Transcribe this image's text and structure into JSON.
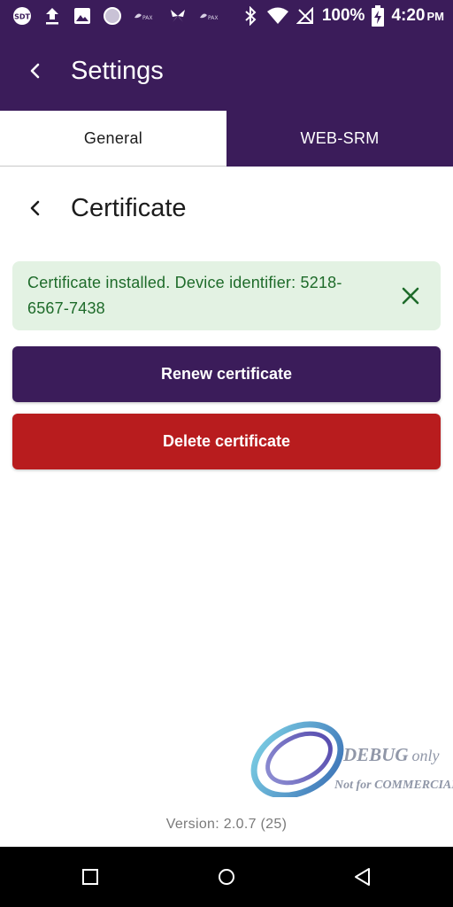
{
  "status_bar": {
    "icons": [
      "sdt-icon",
      "upload-icon",
      "image-icon",
      "circle-app-icon",
      "pax-icon",
      "butterfly-icon",
      "pax-icon",
      "bluetooth-icon",
      "wifi-icon",
      "no-signal-icon",
      "battery-charging-icon"
    ],
    "battery_percent": "100%",
    "time": "4:20",
    "time_suffix": "PM"
  },
  "app_bar": {
    "title": "Settings"
  },
  "tabs": [
    {
      "label": "General",
      "active": true
    },
    {
      "label": "WEB-SRM",
      "active": false
    }
  ],
  "page": {
    "title": "Certificate"
  },
  "alert": {
    "message": "Certificate installed. Device identifier: 5218-6567-7438",
    "color": "#1e6b2a",
    "background": "#e3f2e3"
  },
  "actions": {
    "renew_label": "Renew certificate",
    "delete_label": "Delete certificate"
  },
  "watermark": {
    "line1_bold": "DEBUG",
    "line1_rest": "only",
    "line2": "Not for COMMERCIAL"
  },
  "footer": {
    "version": "Version: 2.0.7 (25)"
  },
  "colors": {
    "primary": "#3b1c5a",
    "danger": "#b81c1e",
    "success_text": "#1e6b2a"
  }
}
